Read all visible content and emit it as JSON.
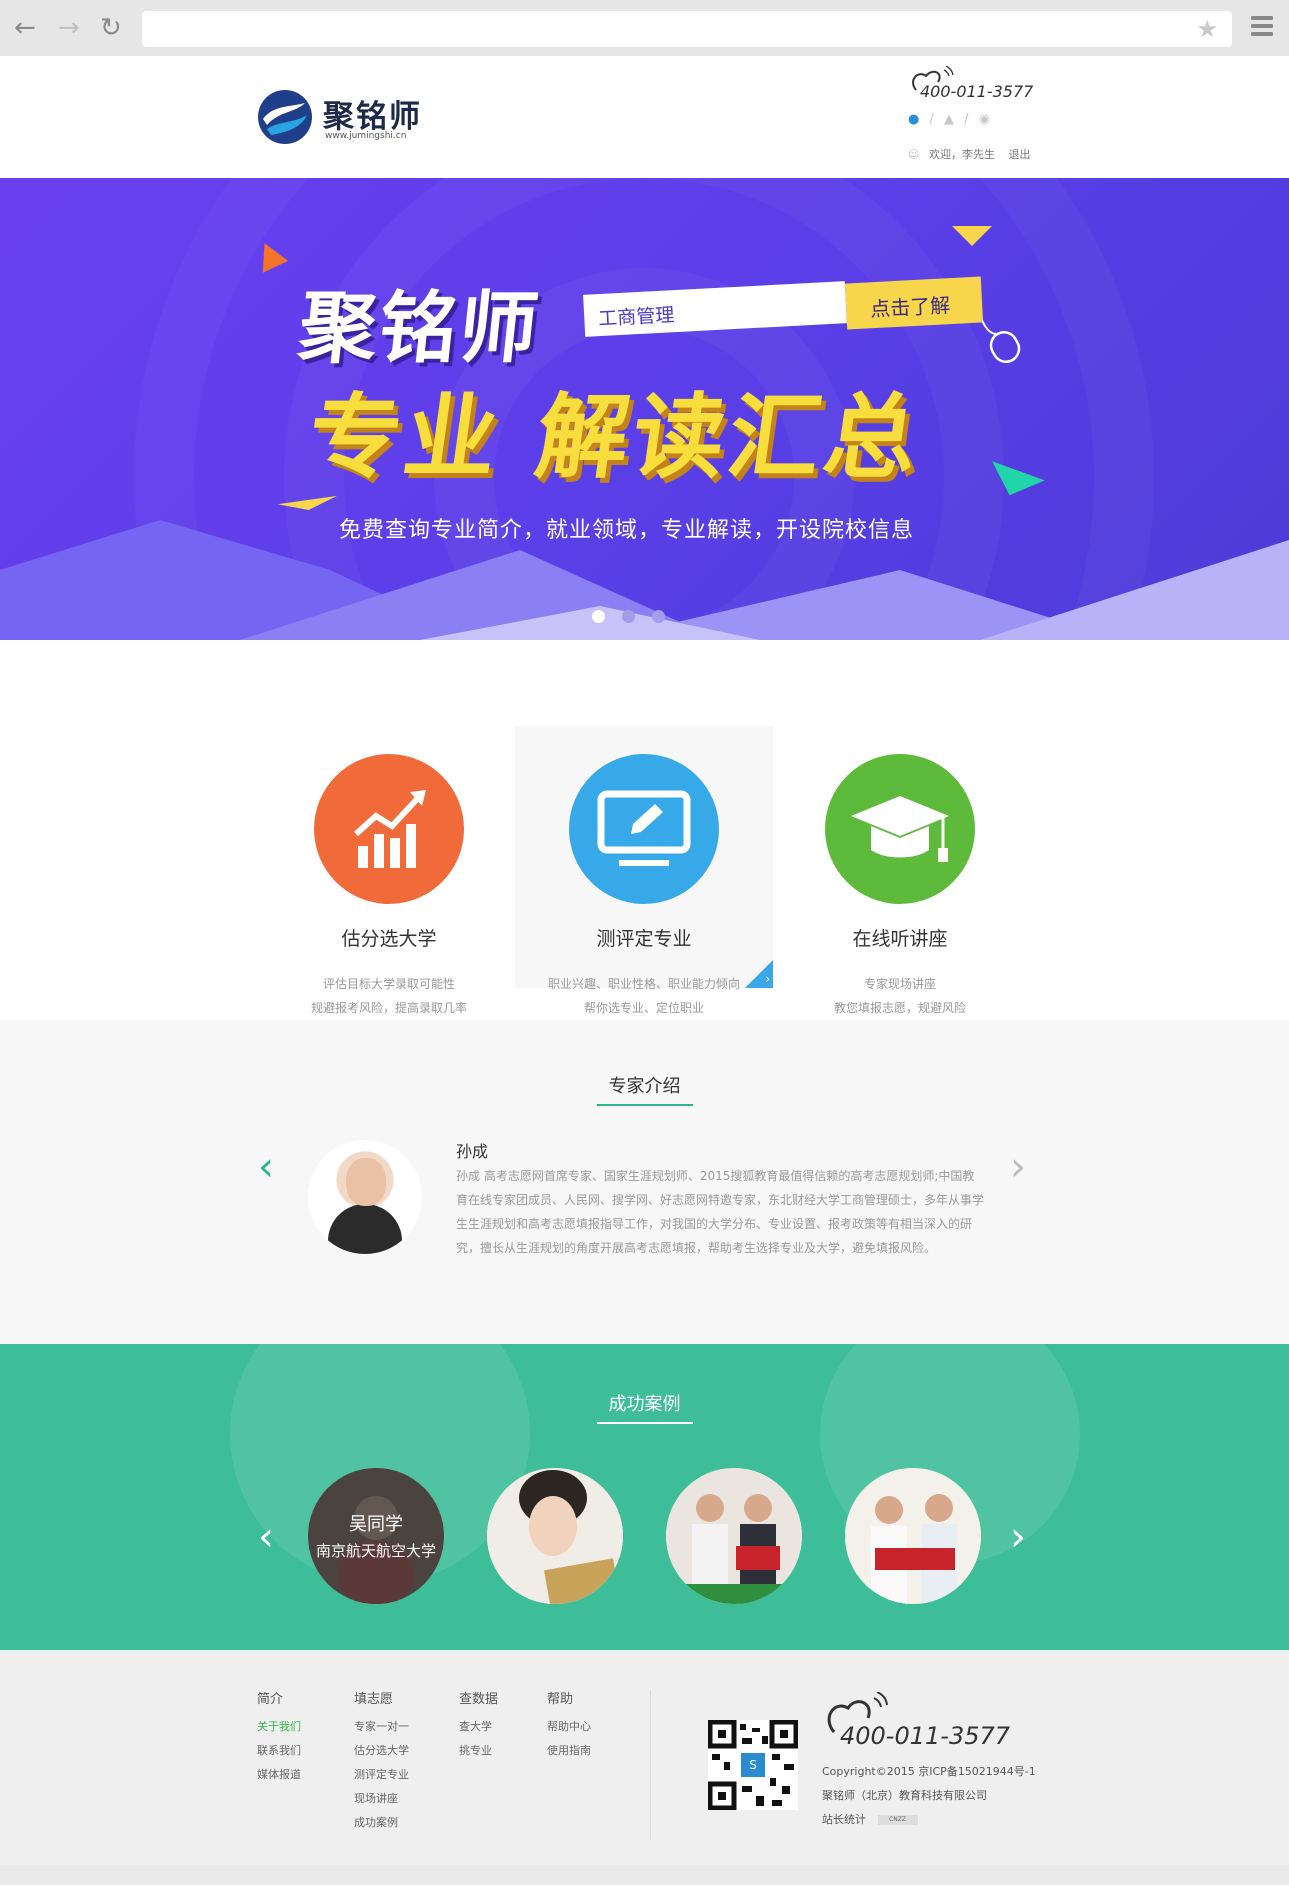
{
  "browser": {
    "back_icon": "arrow-left-icon",
    "forward_icon": "arrow-right-icon",
    "reload_icon": "reload-icon",
    "address": "",
    "star_icon": "star-icon",
    "menu_icon": "hamburger-menu-icon"
  },
  "header": {
    "logo_name": "聚铭师",
    "logo_url": "www.jumingshi.cn",
    "hotline": "400-011-3577",
    "social": [
      "qq-icon",
      "weibo-icon",
      "wechat-icon"
    ],
    "welcome": "欢迎，李先生",
    "logout": "退出"
  },
  "banner": {
    "title_line1": "聚铭师",
    "title_line2": "专业 解读汇总",
    "search_text": "工商管理",
    "search_button": "点击了解",
    "subtitle": "免费查询专业简介，就业领域，专业解读，开设院校信息",
    "dots": 3,
    "active_dot": 0
  },
  "features": [
    {
      "title": "估分选大学",
      "desc1": "评估目标大学录取可能性",
      "desc2": "规避报考风险，提高录取几率",
      "color": "#f06a3a",
      "icon": "chart-growth-icon"
    },
    {
      "title": "测评定专业",
      "desc1": "职业兴趣、职业性格、职业能力倾向",
      "desc2": "帮你选专业、定位职业",
      "color": "#38a9e8",
      "icon": "monitor-edit-icon"
    },
    {
      "title": "在线听讲座",
      "desc1": "专家现场讲座",
      "desc2": "教您填报志愿，规避风险",
      "color": "#5dba3b",
      "icon": "graduation-cap-icon"
    }
  ],
  "experts": {
    "section_title": "专家介绍",
    "name": "孙成",
    "bio": "孙成 高考志愿网首席专家、国家生涯规划师、2015搜狐教育最值得信赖的高考志愿规划师;中国教育在线专家团成员、人民网、搜学网、好志愿网特邀专家，东北财经大学工商管理硕士，多年从事学生生涯规划和高考志愿填报指导工作，对我国的大学分布、专业设置、报考政策等有相当深入的研究，擅长从生涯规划的角度开展高考志愿填报，帮助考生选择专业及大学，避免填报风险。"
  },
  "cases": {
    "section_title": "成功案例",
    "items": [
      {
        "name": "吴同学",
        "school": "南京航天航空大学"
      },
      {
        "name": "",
        "school": ""
      },
      {
        "name": "",
        "school": ""
      },
      {
        "name": "",
        "school": ""
      }
    ]
  },
  "footer": {
    "columns": [
      {
        "heading": "简介",
        "links": [
          "关于我们",
          "联系我们",
          "媒体报道"
        ]
      },
      {
        "heading": "填志愿",
        "links": [
          "专家一对一",
          "估分选大学",
          "测评定专业",
          "现场讲座",
          "成功案例"
        ]
      },
      {
        "heading": "查数据",
        "links": [
          "查大学",
          "挑专业"
        ]
      },
      {
        "heading": "帮助",
        "links": [
          "帮助中心",
          "使用指南"
        ]
      }
    ],
    "hotline": "400-011-3577",
    "copyright": "Copyright©2015 京ICP备15021944号-1",
    "company": "聚铭师（北京）教育科技有限公司",
    "stats": "站长统计",
    "cnzz": "CNZZ"
  }
}
